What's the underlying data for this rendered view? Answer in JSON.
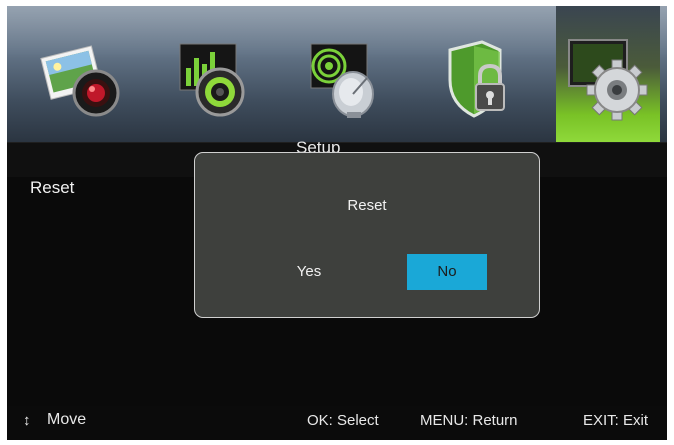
{
  "top_menu": {
    "items": [
      {
        "name": "Picture",
        "icon": "photo-camera-icon"
      },
      {
        "name": "Sound",
        "icon": "speaker-equalizer-icon"
      },
      {
        "name": "Channel",
        "icon": "satellite-dish-icon"
      },
      {
        "name": "Lock",
        "icon": "shield-lock-icon"
      },
      {
        "name": "Setup",
        "icon": "gear-monitor-icon",
        "active": true
      }
    ]
  },
  "section": {
    "title": "Setup"
  },
  "list": {
    "items": [
      {
        "label": "Reset"
      }
    ]
  },
  "dialog": {
    "title": "Reset",
    "yes_label": "Yes",
    "no_label": "No",
    "selected": "No"
  },
  "status_bar": {
    "move_icon": "↕",
    "move_label": "Move",
    "ok_hint": "OK: Select",
    "menu_hint": "MENU: Return",
    "exit_hint": "EXIT: Exit"
  },
  "colors": {
    "accent": "#1aa8d7",
    "active_tab": "#8fd93a",
    "dialog_bg": "#3e403d"
  }
}
